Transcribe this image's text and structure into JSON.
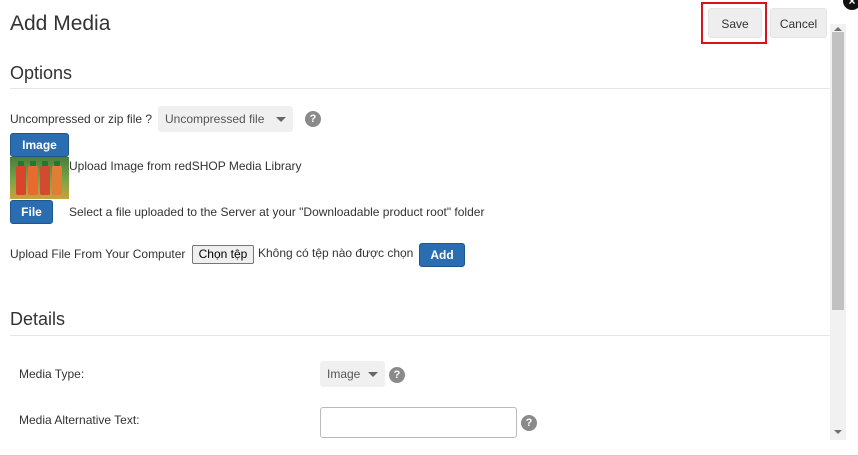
{
  "header": {
    "title": "Add Media",
    "close_glyph": "×",
    "save_label": "Save",
    "cancel_label": "Cancel"
  },
  "options": {
    "section_title": "Options",
    "zip_label": "Uncompressed or zip file ?",
    "zip_value": "Uncompressed file",
    "help_glyph": "?",
    "image_button": "Image",
    "image_library_text": "Upload Image from redSHOP Media Library",
    "file_button": "File",
    "file_text": "Select a file uploaded to the Server at your \"Downloadable product root\" folder",
    "upload_label": "Upload File From Your Computer",
    "choose_file_button": "Chọn tệp",
    "no_file_text": "Không có tệp nào được chọn",
    "add_button": "Add"
  },
  "details": {
    "section_title": "Details",
    "media_type_label": "Media Type:",
    "media_type_value": "Image",
    "alt_text_label": "Media Alternative Text:",
    "alt_text_value": ""
  },
  "colors": {
    "primary_button": "#2a6db0",
    "highlight_border": "#d9121f"
  }
}
